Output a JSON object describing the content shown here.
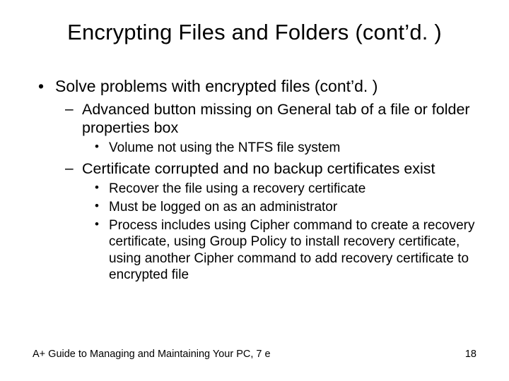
{
  "title": "Encrypting Files and Folders (cont’d. )",
  "bullets": {
    "l1": {
      "text": "Solve problems with encrypted files (cont’d. )",
      "children": [
        {
          "text": "Advanced button missing on General tab of a file or folder properties box",
          "children": [
            {
              "text": "Volume not using the NTFS file system"
            }
          ]
        },
        {
          "text": "Certificate corrupted and no backup certificates exist",
          "children": [
            {
              "text": "Recover the file using a recovery certificate"
            },
            {
              "text": "Must be logged on as an administrator"
            },
            {
              "text": "Process includes using Cipher command to create a recovery certificate, using Group Policy to install recovery certificate, using another Cipher command to add recovery certificate to encrypted file"
            }
          ]
        }
      ]
    }
  },
  "footer": {
    "left": "A+ Guide to Managing and Maintaining Your PC, 7 e",
    "page": "18"
  }
}
